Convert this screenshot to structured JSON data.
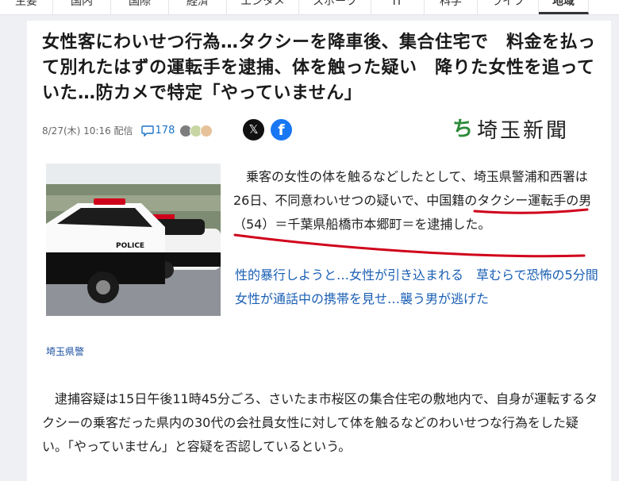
{
  "nav": {
    "tabs": [
      {
        "label": "主要",
        "w": 66
      },
      {
        "label": "国内",
        "w": 72
      },
      {
        "label": "国際",
        "w": 72
      },
      {
        "label": "経済",
        "w": 72
      },
      {
        "label": "エンタメ",
        "w": 90
      },
      {
        "label": "スポーツ",
        "w": 90
      },
      {
        "label": "IT",
        "w": 66
      },
      {
        "label": "科学",
        "w": 66
      },
      {
        "label": "ライフ",
        "w": 76
      },
      {
        "label": "地域",
        "w": 62,
        "active": true
      }
    ]
  },
  "article": {
    "headline": "女性客にわいせつ行為…タクシーを降車後、集合住宅で　料金を払って別れたはずの運転手を逮捕、体を触った疑い　降りた女性を追っていた…防カメで特定「やっていません」",
    "date": "8/27(木) 10:16 配信",
    "comment_count": "178",
    "publisher_name": "埼玉新聞",
    "publisher_mark": "ち",
    "photo_caption": "埼玉県警",
    "photo_label": "POLICE",
    "lead": "乗客の女性の体を触るなどしたとして、埼玉県警浦和西署は26日、不同意わいせつの疑いで、中国籍のタクシー運転手の男（54）＝千葉県船橋市本郷町＝を逮捕した。",
    "related_link": "性的暴行しようと…女性が引き込まれる　草むらで恐怖の5分間　女性が通話中の携帯を見せ…襲う男が逃げた",
    "body": "逮捕容疑は15日午後11時45分ごろ、さいたま市桜区の集合住宅の敷地内で、自身が運転するタクシーの乗客だった県内の30代の会社員女性に対して体を触るなどのわいせつな行為をした疑い。「やっていません」と容疑を否認しているという。"
  },
  "colors": {
    "link": "#1a5fb4",
    "underline": "#d0021b",
    "publisher_green": "#2e8b3a"
  }
}
